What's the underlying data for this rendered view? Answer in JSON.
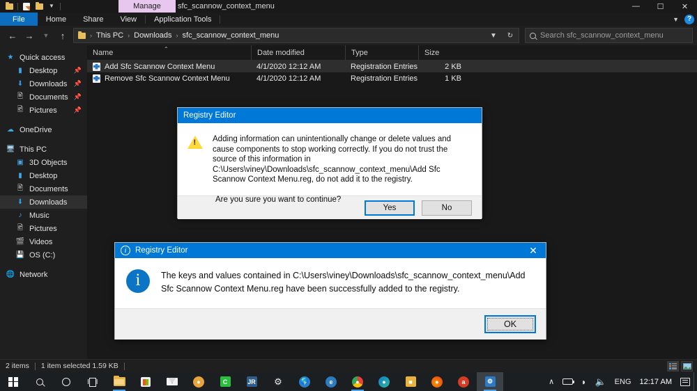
{
  "window": {
    "title": "sfc_scannow_context_menu",
    "contextual_tab": "Manage",
    "quick_access_icons": [
      "folder-icon",
      "properties-icon",
      "new-folder-icon",
      "chevron-down-icon"
    ],
    "controls": {
      "minimize": "—",
      "maximize": "❐",
      "close": "✕"
    },
    "ribbon": {
      "tabs": [
        "File",
        "Home",
        "Share",
        "View",
        "Application Tools"
      ],
      "collapse_icon": "chevron-down-icon",
      "help_icon": "help-icon",
      "help_label": "?"
    }
  },
  "address": {
    "back": "←",
    "forward": "→",
    "recent": "⌄",
    "up": "↑",
    "folder_icon": "folder-icon",
    "breadcrumbs": [
      "This PC",
      "Downloads",
      "sfc_scannow_context_menu"
    ],
    "separator": "›",
    "dropdown": "⌄",
    "refresh": "↻"
  },
  "search": {
    "placeholder": "Search sfc_scannow_context_menu",
    "icon": "search-icon"
  },
  "sidebar": {
    "groups": [
      {
        "items": [
          {
            "label": "Quick access",
            "icon": "star-icon",
            "indent": 0,
            "pinned": false,
            "selected": false
          },
          {
            "label": "Desktop",
            "icon": "desktop-icon",
            "indent": 1,
            "pinned": true,
            "selected": false
          },
          {
            "label": "Downloads",
            "icon": "download-icon",
            "indent": 1,
            "pinned": true,
            "selected": false
          },
          {
            "label": "Documents",
            "icon": "documents-icon",
            "indent": 1,
            "pinned": true,
            "selected": false
          },
          {
            "label": "Pictures",
            "icon": "pictures-icon",
            "indent": 1,
            "pinned": true,
            "selected": false
          }
        ]
      },
      {
        "items": [
          {
            "label": "OneDrive",
            "icon": "onedrive-icon",
            "indent": 0,
            "pinned": false,
            "selected": false
          }
        ]
      },
      {
        "items": [
          {
            "label": "This PC",
            "icon": "thispc-icon",
            "indent": 0,
            "pinned": false,
            "selected": false
          },
          {
            "label": "3D Objects",
            "icon": "3dobjects-icon",
            "indent": 1,
            "pinned": false,
            "selected": false
          },
          {
            "label": "Desktop",
            "icon": "desktop-icon",
            "indent": 1,
            "pinned": false,
            "selected": false
          },
          {
            "label": "Documents",
            "icon": "documents-icon",
            "indent": 1,
            "pinned": false,
            "selected": false
          },
          {
            "label": "Downloads",
            "icon": "download-icon",
            "indent": 1,
            "pinned": false,
            "selected": true
          },
          {
            "label": "Music",
            "icon": "music-icon",
            "indent": 1,
            "pinned": false,
            "selected": false
          },
          {
            "label": "Pictures",
            "icon": "pictures-icon",
            "indent": 1,
            "pinned": false,
            "selected": false
          },
          {
            "label": "Videos",
            "icon": "videos-icon",
            "indent": 1,
            "pinned": false,
            "selected": false
          },
          {
            "label": "OS (C:)",
            "icon": "drive-icon",
            "indent": 1,
            "pinned": false,
            "selected": false
          }
        ]
      },
      {
        "items": [
          {
            "label": "Network",
            "icon": "network-icon",
            "indent": 0,
            "pinned": false,
            "selected": false
          }
        ]
      }
    ]
  },
  "filelist": {
    "columns": [
      "Name",
      "Date modified",
      "Type",
      "Size"
    ],
    "sort_column": "Name",
    "sort_caret": "⌃",
    "rows": [
      {
        "name": "Add Sfc Scannow Context Menu",
        "date": "4/1/2020 12:12 AM",
        "type": "Registration Entries",
        "size": "2 KB",
        "icon": "registry-file-icon",
        "selected": true
      },
      {
        "name": "Remove Sfc Scannow Context Menu",
        "date": "4/1/2020 12:12 AM",
        "type": "Registration Entries",
        "size": "1 KB",
        "icon": "registry-file-icon",
        "selected": false
      }
    ]
  },
  "statusbar": {
    "item_count": "2 items",
    "selection": "1 item selected  1.59 KB",
    "view_details_icon": "details-view-icon",
    "view_icons_icon": "large-icons-view-icon"
  },
  "dialog_warning": {
    "title": "Registry Editor",
    "icon": "warning-icon",
    "message": "Adding information can unintentionally change or delete values and cause components to stop working correctly. If you do not trust the source of this information in C:\\Users\\viney\\Downloads\\sfc_scannow_context_menu\\Add Sfc Scannow Context Menu.reg, do not add it to the registry.",
    "question": "Are you sure you want to continue?",
    "yes_label": "Yes",
    "no_label": "No"
  },
  "dialog_info": {
    "title": "Registry Editor",
    "title_icon": "info-icon",
    "close_icon": "close-icon",
    "icon": "info-icon",
    "icon_glyph": "i",
    "message": "The keys and values contained in C:\\Users\\viney\\Downloads\\sfc_scannow_context_menu\\Add Sfc Scannow Context Menu.reg have been successfully added to the registry.",
    "ok_label": "OK"
  },
  "taskbar": {
    "items": [
      {
        "name": "start-button",
        "icon": "windows-logo-icon",
        "active": false,
        "running": false
      },
      {
        "name": "search-button",
        "icon": "search-icon",
        "active": false,
        "running": false
      },
      {
        "name": "cortana-button",
        "icon": "cortana-icon",
        "active": false,
        "running": false
      },
      {
        "name": "task-view-button",
        "icon": "task-view-icon",
        "active": false,
        "running": false
      },
      {
        "name": "file-explorer",
        "icon": "folder-icon",
        "active": false,
        "running": true
      },
      {
        "name": "microsoft-store",
        "icon": "store-icon",
        "active": false,
        "running": false
      },
      {
        "name": "mail",
        "icon": "mail-icon",
        "active": false,
        "running": false
      },
      {
        "name": "app-orange",
        "icon": "app-icon",
        "active": false,
        "running": false
      },
      {
        "name": "app-green",
        "icon": "app-icon",
        "active": false,
        "running": false
      },
      {
        "name": "app-jr",
        "icon": "app-icon",
        "active": false,
        "running": false
      },
      {
        "name": "settings",
        "icon": "gear-icon",
        "active": false,
        "running": false
      },
      {
        "name": "app-globe",
        "icon": "app-icon",
        "active": false,
        "running": false
      },
      {
        "name": "edge-legacy",
        "icon": "edge-icon",
        "active": false,
        "running": false
      },
      {
        "name": "google-chrome",
        "icon": "chrome-icon",
        "active": false,
        "running": true
      },
      {
        "name": "microsoft-edge",
        "icon": "edge-icon",
        "active": false,
        "running": false
      },
      {
        "name": "app-yellow",
        "icon": "app-icon",
        "active": false,
        "running": false
      },
      {
        "name": "mozilla-firefox",
        "icon": "firefox-icon",
        "active": false,
        "running": false
      },
      {
        "name": "app-red",
        "icon": "app-icon",
        "active": false,
        "running": false
      },
      {
        "name": "registry-editor",
        "icon": "registry-icon",
        "active": true,
        "running": true
      }
    ],
    "tray": {
      "overflow_icon": "chevron-up-icon",
      "overflow_glyph": "∧",
      "battery_icon": "battery-icon",
      "network_icon": "wifi-icon",
      "network_glyph": "◠",
      "volume_icon": "volume-icon",
      "volume_glyph": "🔊",
      "language": "ENG",
      "clock": "12:17 AM",
      "notifications_icon": "notifications-icon"
    }
  }
}
